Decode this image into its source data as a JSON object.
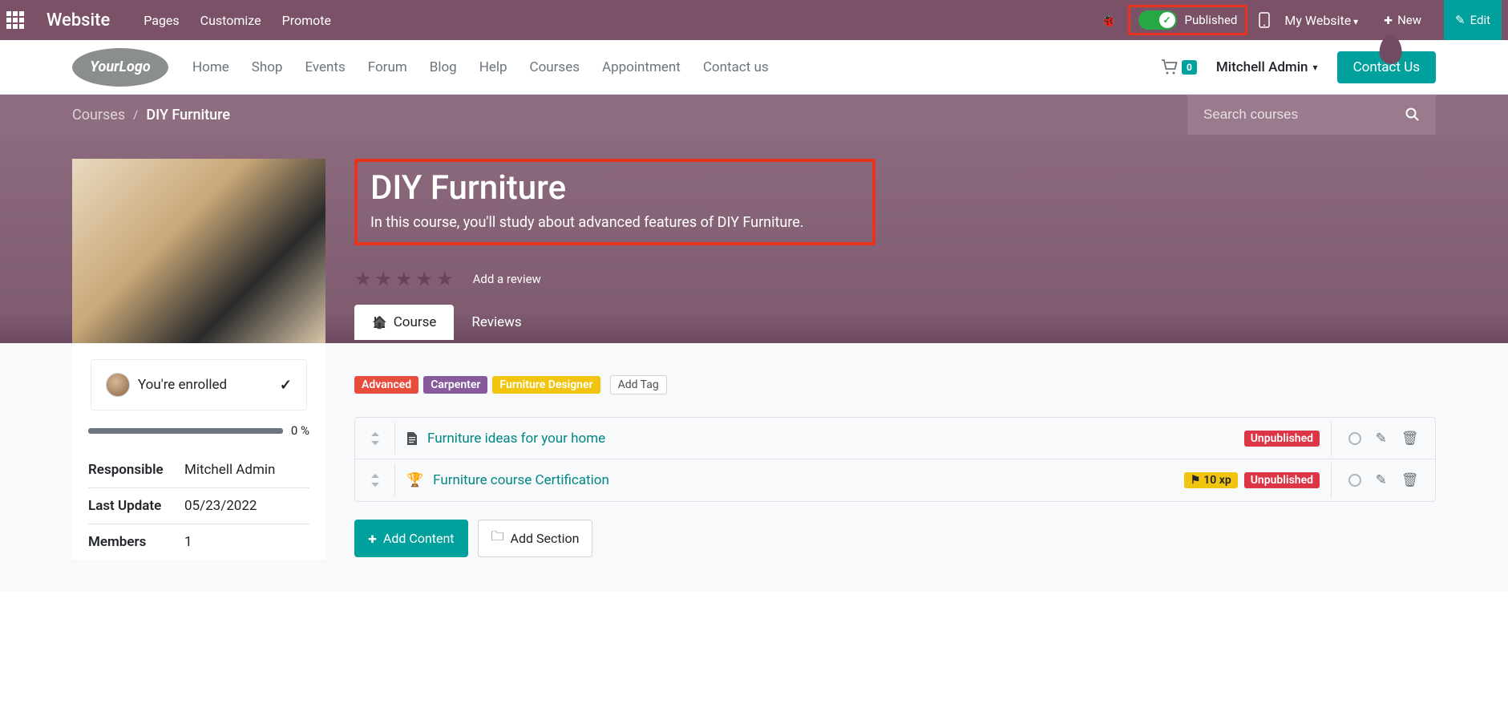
{
  "topbar": {
    "title": "Website",
    "links": [
      "Pages",
      "Customize",
      "Promote"
    ],
    "published_label": "Published",
    "my_website": "My Website",
    "new_label": "New",
    "edit_label": "Edit"
  },
  "mainnav": {
    "items": [
      "Home",
      "Shop",
      "Events",
      "Forum",
      "Blog",
      "Help",
      "Courses",
      "Appointment",
      "Contact us"
    ],
    "cart_count": "0",
    "user": "Mitchell Admin",
    "contact_btn": "Contact Us"
  },
  "breadcrumb": {
    "parent": "Courses",
    "current": "DIY Furniture"
  },
  "search": {
    "placeholder": "Search courses"
  },
  "hero": {
    "title": "DIY Furniture",
    "subtitle": "In this course, you'll study about advanced features of DIY Furniture.",
    "review_link": "Add a review",
    "tabs": [
      "Course",
      "Reviews"
    ]
  },
  "sidebar": {
    "enrolled_text": "You're enrolled",
    "progress_pct": "0 %",
    "meta": [
      {
        "label": "Responsible",
        "value": "Mitchell Admin"
      },
      {
        "label": "Last Update",
        "value": "05/23/2022"
      },
      {
        "label": "Members",
        "value": "1"
      }
    ]
  },
  "content": {
    "tags": [
      {
        "text": "Advanced",
        "cls": "red"
      },
      {
        "text": "Carpenter",
        "cls": "purple"
      },
      {
        "text": "Furniture Designer",
        "cls": "yellow"
      }
    ],
    "add_tag": "Add Tag",
    "items": [
      {
        "icon": "file",
        "title": "Furniture ideas for your home",
        "xp": null,
        "status": "Unpublished"
      },
      {
        "icon": "trophy",
        "title": "Furniture course Certification",
        "xp": "10 xp",
        "status": "Unpublished"
      }
    ],
    "add_content": "Add Content",
    "add_section": "Add Section"
  }
}
